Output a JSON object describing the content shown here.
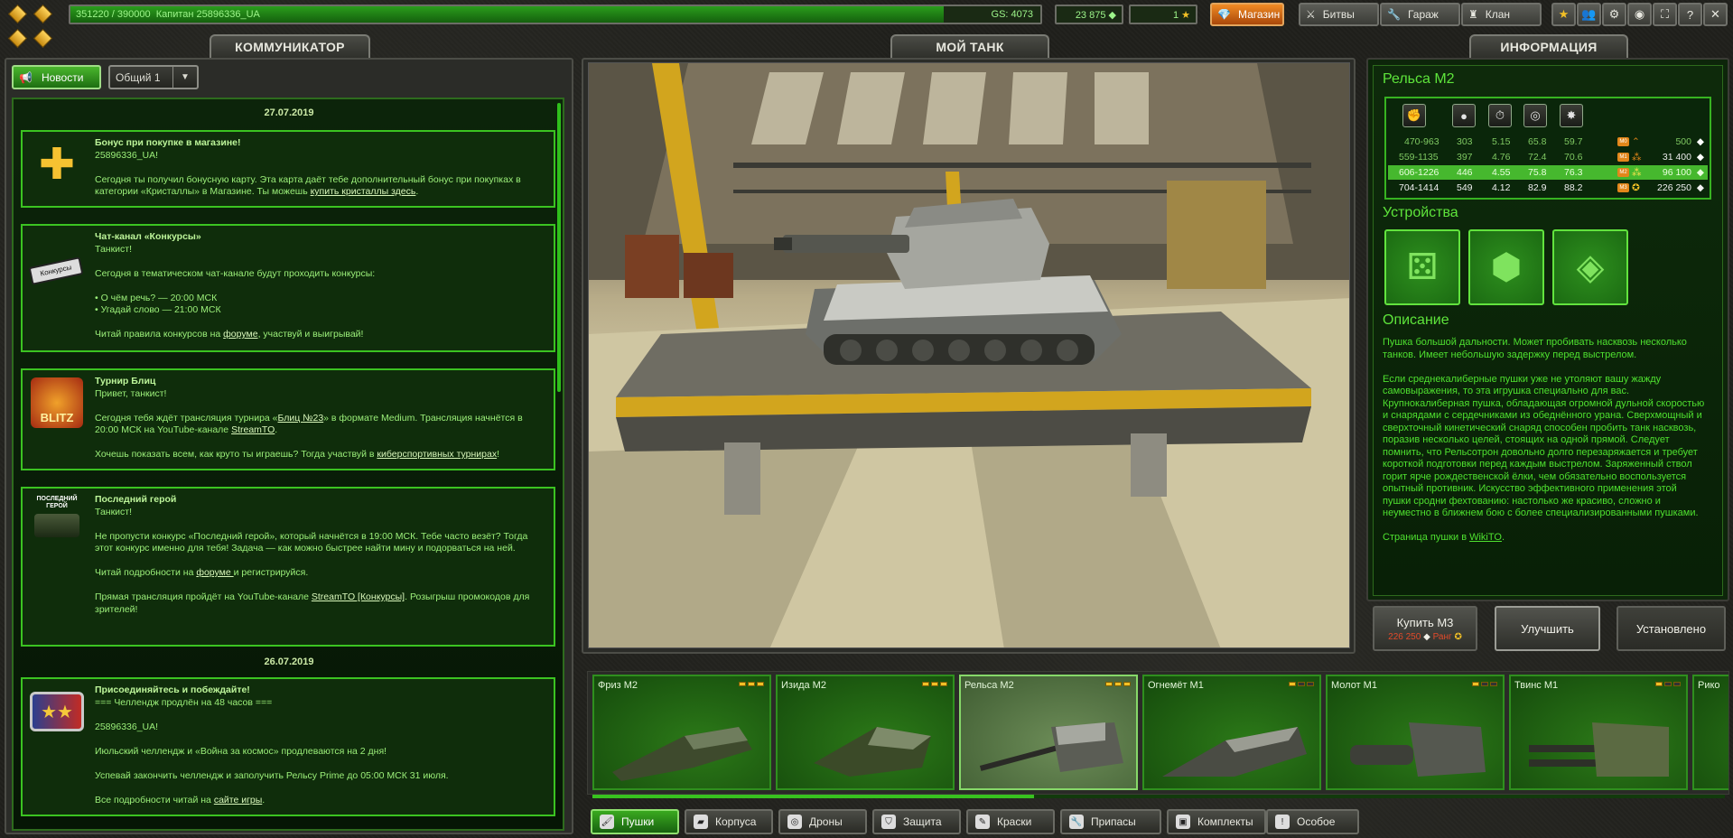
{
  "topbar": {
    "xp": "351220 / 390000",
    "rank_user": "Капитан 25896336_UA",
    "gs": "GS: 4073",
    "crystals": "23 875",
    "stars": "1",
    "shop": "Магазин",
    "battles": "Битвы",
    "garage": "Гараж",
    "clan": "Клан",
    "xp_progress": 0.9
  },
  "left": {
    "header": "КОММУНИКАТОР",
    "news_btn": "Новости",
    "channel": "Общий 1",
    "date1": "27.07.2019",
    "date2": "26.07.2019",
    "cards": [
      {
        "title": "Бонус при покупке в магазине!",
        "l1": "25896336_UA!",
        "l2": "Сегодня ты получил бонусную карту. Эта карта даёт тебе дополнительный бонус при покупках в категории «Кристаллы» в Магазине. Ты можешь ",
        "link": "купить кристаллы здесь",
        "end": "."
      },
      {
        "title": "Чат-канал «Конкурсы»",
        "l1": "Танкист!",
        "l2": "Сегодня в тематическом чат-канале будут проходить конкурсы:",
        "l3": "• О чём речь? — 20:00 МСК",
        "l4": "• Угадай слово — 21:00 МСК",
        "l5a": "Читай правила конкурсов на ",
        "link": "форуме",
        "l5b": ", участвуй и выигрывай!",
        "badge": "Конкурсы"
      },
      {
        "title": "Турнир Блиц",
        "l1": "Привет, танкист!",
        "l2a": " Сегодня тебя ждёт трансляция турнира «",
        "link1": "Блиц №23",
        "l2b": "» в формате Medium. Трансляция начнётся в 20:00 МСК на YouTube-канале ",
        "link2": "StreamTO",
        "l2c": ".",
        "l3a": "Хочешь показать всем, как круто ты играешь? Тогда участвуй в ",
        "link3": "киберспортивных турнирах",
        "l3b": "!",
        "logo": "BLITZ"
      },
      {
        "title": "Последний герой",
        "l1": "Танкист!",
        "l2": "Не пропусти конкурс «Последний герой», который начнётся в 19:00 МСК. Тебе часто везёт? Тогда этот конкурс именно для тебя! Задача — как можно быстрее найти мину и подорваться на ней.",
        "l3a": "Читай подробности на ",
        "link1": " форуме ",
        "l3b": " и регистрируйся.",
        "l4a": "Прямая трансляция пройдёт на YouTube-канале ",
        "link2": "StreamTO [Конкурсы]",
        "l4b": ". Розыгрыш промокодов для зрителей!",
        "logo": "ПОСЛЕДНИЙ ГЕРОЙ"
      },
      {
        "title": "Присоединяйтесь и побеждайте!",
        "l1": "=== Челлендж продлён на 48 часов ===",
        "l2": "25896336_UA!",
        "l3": "Июльский челлендж и «Война за космос» продлеваются на 2 дня!",
        "l4": "Успевай закончить челлендж и заполучить Рельсу Prime до 05:00 МСК 31 июля.",
        "l5a": "Все подробности читай на ",
        "link": "сайте игры",
        "l5b": "."
      }
    ]
  },
  "center": {
    "header": "МОЙ ТАНК"
  },
  "right": {
    "header": "ИНФОРМАЦИЯ",
    "title": "Рельса M2",
    "rows": [
      {
        "dmg": "470-963",
        "a": "303",
        "b": "5.15",
        "c": "65.8",
        "d": "59.7",
        "mk": "M0",
        "price": "500"
      },
      {
        "dmg": "559-1135",
        "a": "397",
        "b": "4.76",
        "c": "72.4",
        "d": "70.6",
        "mk": "M1",
        "price": "31 400"
      },
      {
        "dmg": "606-1226",
        "a": "446",
        "b": "4.55",
        "c": "75.8",
        "d": "76.3",
        "mk": "M2",
        "price": "96 100"
      },
      {
        "dmg": "704-1414",
        "a": "549",
        "b": "4.12",
        "c": "82.9",
        "d": "88.2",
        "mk": "M3",
        "price": "226 250"
      }
    ],
    "devices_title": "Устройства",
    "desc_title": "Описание",
    "desc1": "Пушка большой дальности. Может пробивать насквозь несколько танков. Имеет небольшую задержку перед выстрелом.",
    "desc2": "Если среднекалиберные пушки уже не утоляют вашу жажду самовыражения, то эта игрушка специально для вас. Крупнокалиберная пушка, обладающая огромной дульной скоростью и снарядами с сердечниками из обеднённого урана. Сверхмощный и сверхточный кинетический снаряд способен пробить танк насквозь, поразив несколько целей, стоящих на одной прямой. Следует помнить, что Рельсотрон довольно долго перезаряжается и требует короткой подготовки перед каждым выстрелом. Заряженный ствол горит ярче рождественской ёлки, чем обязательно воспользуется опытный противник. Искусство эффективного применения этой пушки сродни фехтованию: настолько же красиво, сложно и неуместно в ближнем бою с более специализированными пушками.",
    "desc3a": "Страница пушки в ",
    "desc3link": "WikiTO",
    "desc3b": ".",
    "buy": "Купить M3",
    "buy_price": "226 250",
    "buy_rank": "Ранг",
    "upgrade": "Улучшить",
    "installed": "Установлено"
  },
  "carousel": {
    "items": [
      {
        "name": "Фриз M2"
      },
      {
        "name": "Изида M2"
      },
      {
        "name": "Рельса M2"
      },
      {
        "name": "Огнемёт M1"
      },
      {
        "name": "Молот M1"
      },
      {
        "name": "Твинс M1"
      },
      {
        "name": "Рико"
      }
    ],
    "progress": 0.39
  },
  "categories": [
    "Пушки",
    "Корпуса",
    "Дроны",
    "Защита",
    "Краски",
    "Припасы",
    "Комплекты",
    "Особое"
  ]
}
